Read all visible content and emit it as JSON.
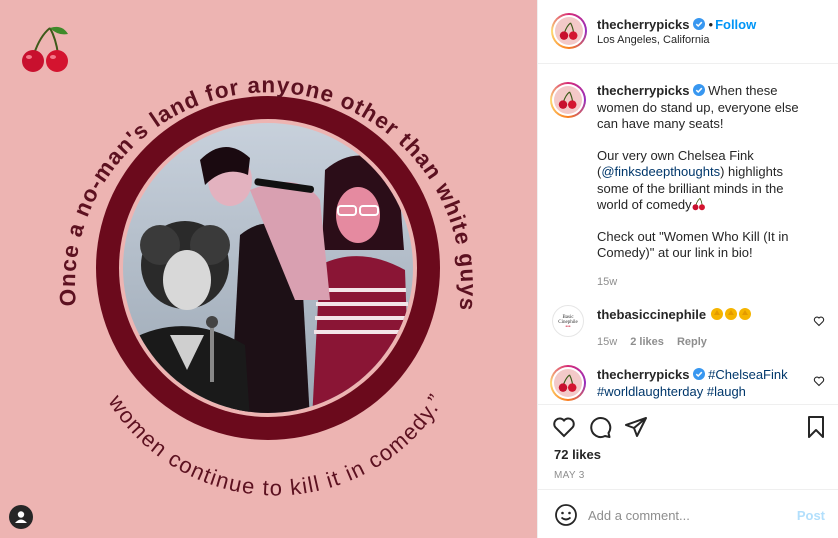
{
  "post_image": {
    "quote_top": "“Once a no-man's land for anyone other than white guys,",
    "quote_bottom": "women continue to kill it in comedy.”"
  },
  "header": {
    "username": "thecherrypicks",
    "separator": "•",
    "follow_label": "Follow",
    "location": "Los Angeles, California"
  },
  "caption": {
    "username": "thecherrypicks",
    "line1": "When these women do stand up, everyone else can have many seats!",
    "para2_before": "Our very own Chelsea Fink (",
    "para2_mention": "@finksdeepthoughts",
    "para2_after": ") highlights some of the brilliant minds in the world of comedy",
    "para3": "Check out \"Women Who Kill (It in Comedy)\" at our link in bio!",
    "time": "15w"
  },
  "comments": [
    {
      "username": "thebasiccinephile",
      "avatar_text": [
        "Basic",
        "Cinephile",
        "•••"
      ],
      "time": "15w",
      "likes": "2 likes",
      "reply": "Reply"
    },
    {
      "username": "thecherrypicks",
      "tag1": "#ChelseaFink",
      "tag2": "#worldlaughterday",
      "tag3": "#laugh"
    }
  ],
  "actions": {
    "likes_text": "72 likes",
    "date": "MAY 3"
  },
  "add_comment": {
    "placeholder": "Add a comment...",
    "post_label": "Post"
  },
  "icons": [
    "cherry-icon",
    "verified-icon",
    "heart-icon",
    "comment-icon",
    "share-icon",
    "bookmark-icon",
    "smile-icon",
    "user-tag-icon",
    "clap-icon"
  ],
  "colors": {
    "background_pink": "#edb4b2",
    "ring_maroon": "#6b0a1c",
    "accent_blue": "#0095f6",
    "link_blue": "#00376b"
  }
}
